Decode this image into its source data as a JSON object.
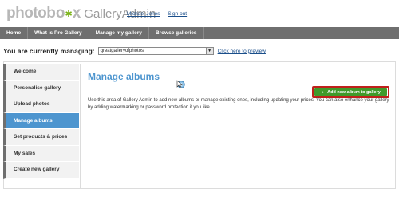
{
  "header": {
    "logo_part1": "photo",
    "logo_part2": "x",
    "logo_star": "✱",
    "product_name": "GalleryAdmin",
    "user_name": "Michael Jones",
    "separator": "|",
    "sign_out": "Sign out"
  },
  "nav": {
    "items": [
      "Home",
      "What is Pro Gallery",
      "Manage my gallery",
      "Browse galleries"
    ]
  },
  "managing": {
    "label": "You are currently managing:",
    "selected_gallery": "greatgalleryofphotos",
    "preview_link": "Click here to preview"
  },
  "sidebar": {
    "items": [
      {
        "label": "Welcome",
        "active": false
      },
      {
        "label": "Personalise gallery",
        "active": false
      },
      {
        "label": "Upload photos",
        "active": false
      },
      {
        "label": "Manage albums",
        "active": true
      },
      {
        "label": "Set products & prices",
        "active": false
      },
      {
        "label": "My sales",
        "active": false
      },
      {
        "label": "Create new gallery",
        "active": false
      }
    ]
  },
  "main": {
    "title": "Manage albums",
    "add_button": "Add new album to gallery",
    "description": "Use this area of Gallery Admin to add new albums or manage existing ones, including updating your prices. You can also enhance your gallery by adding watermarking or password protection if you like."
  },
  "footer": {
    "text": ""
  },
  "colors": {
    "accent": "#4d95cf",
    "nav_bg": "#6f6f6f",
    "button_green": "#3f9a2a",
    "highlight_red": "#c0211c"
  }
}
